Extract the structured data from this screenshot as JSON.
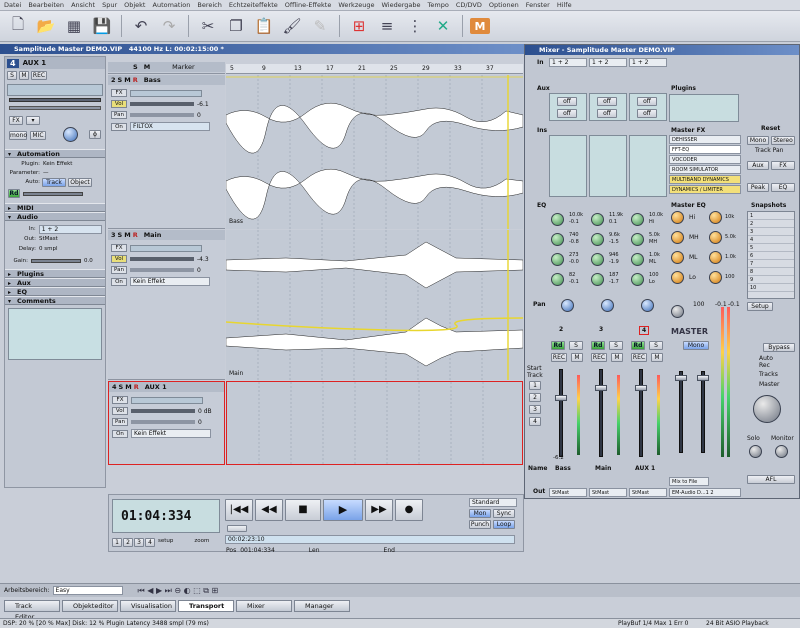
{
  "menu": [
    "Datei",
    "Bearbeiten",
    "Ansicht",
    "Spur",
    "Objekt",
    "Automation",
    "Bereich",
    "Echtzeiteffekte",
    "Offline-Effekte",
    "Werkzeuge",
    "Wiedergabe",
    "Tempo",
    "CD/DVD",
    "Optionen",
    "Fenster",
    "Hilfe"
  ],
  "arrange": {
    "title": "Samplitude Master DEMO.VIP",
    "info": "44100 Hz L: 00:02:15:00 *",
    "ruler": [
      "5",
      "9",
      "13",
      "17",
      "21",
      "25",
      "29",
      "33",
      "37"
    ],
    "marker_label": "Marker"
  },
  "inspector": {
    "track_number": "4",
    "track_name": "AUX 1",
    "mono": "mono",
    "mic": "MIC",
    "automation_header": "Automation",
    "plugin_label": "Plugin:",
    "plugin_value": "Kein Effekt",
    "parameter_label": "Parameter:",
    "auto_label": "Auto:",
    "track_btn": "Track",
    "object_btn": "Object",
    "rd": "Rd",
    "midi_header": "MIDI",
    "audio_header": "Audio",
    "in_label": "In:",
    "in_value": "1 + 2",
    "out_label": "Out:",
    "out_value": "StMast",
    "delay_label": "Delay:",
    "delay_value": "0 smpl",
    "gain_label": "Gain:",
    "gain_value": "0.0",
    "plugins_header": "Plugins",
    "aux_header": "Aux",
    "eq_header": "EQ",
    "comments_header": "Comments"
  },
  "tracks": [
    {
      "num": "2",
      "name": "Bass",
      "fx": "FX",
      "vol": "Vol",
      "vol_val": "-6.1",
      "pan": "Pan",
      "pan_val": "0",
      "on": "On",
      "plugin": "FILTOX",
      "lane_label": "Bass"
    },
    {
      "num": "3",
      "name": "Main",
      "fx": "FX",
      "vol": "Vol",
      "vol_val": "-4.3",
      "pan": "Pan",
      "pan_val": "0",
      "on": "On",
      "plugin": "Kein Effekt",
      "lane_label": "Main"
    },
    {
      "num": "4",
      "name": "AUX 1",
      "fx": "FX",
      "vol": "Vol",
      "vol_val": "0 dB",
      "pan": "Pan",
      "pan_val": "0",
      "on": "On",
      "plugin": "Kein Effekt",
      "lane_label": ""
    }
  ],
  "smr": [
    "S",
    "M",
    "R"
  ],
  "transport": {
    "time": "01:04:334",
    "position_time": "00:02:23:10",
    "pos_label": "Pos",
    "pos_value": "001:04:334",
    "len_label": "Len",
    "end_label": "End",
    "setup": "setup",
    "zoom": "zoom",
    "standard": "Standard",
    "punch": "Punch",
    "loop": "Loop",
    "mon": "Mon",
    "sync": "Sync",
    "edit": "edit",
    "pages": [
      "1",
      "2",
      "3",
      "4"
    ]
  },
  "mixer": {
    "title": "Mixer - Samplitude Master DEMO.VIP",
    "in_label": "In",
    "in_values": [
      "1 + 2",
      "1 + 2",
      "1 + 2"
    ],
    "aux_label": "Aux",
    "ins_label": "Ins",
    "eq_label": "EQ",
    "pan_label": "Pan",
    "out_label": "Out",
    "name_label": "Name",
    "off": "off",
    "plugins_label": "Plugins",
    "master_fx_label": "Master FX",
    "master_fx": [
      "DEHISSER",
      "FFT-EQ",
      "VOCODER",
      "ROOM SIMULATOR",
      "MULTIBAND DYNAMICS",
      "DYNAMICS / LIMITER"
    ],
    "master_eq_label": "Master EQ",
    "eq_bands": [
      "Hi",
      "MH",
      "ML",
      "Lo"
    ],
    "eq_freqs": [
      "10k",
      "5.0k",
      "1.0k",
      "100"
    ],
    "insert": "FILTOX",
    "channel_names": [
      "Bass",
      "Main",
      "AUX 1"
    ],
    "channel_nums": [
      "2",
      "3",
      "4"
    ],
    "channel_eq_values": [
      [
        "10.0k",
        "-0.1",
        "740",
        "-0.8",
        "273",
        "-0.0",
        "82",
        "-0.1"
      ],
      [
        "11.9k",
        "0.1",
        "9.6k",
        "-1.5",
        "946",
        "-1.9",
        "187",
        "-1.7"
      ],
      [
        "10.0k",
        "Hi",
        "5.0k",
        "MH",
        "1.0k",
        "ML",
        "100",
        "Lo"
      ]
    ],
    "master": "MASTER",
    "mono": "Mono",
    "bypass": "Bypass",
    "auto_rec": "Auto Rec",
    "tracks": "Tracks",
    "master_label": "Master",
    "solo": "Solo",
    "monitor": "Monitor",
    "reset": "Reset",
    "mono_btn": "Mono",
    "stereo_btn": "Stereo",
    "track_pan": "Track Pan",
    "aux_btn": "Aux",
    "fx_btn": "FX",
    "peak": "Peak",
    "eq_btn": "EQ",
    "snapshots": "Snapshots",
    "snapshot_nums": [
      "1",
      "2",
      "3",
      "4",
      "5",
      "6",
      "7",
      "8",
      "9",
      "10"
    ],
    "setup": "Setup",
    "start_track": "Start Track",
    "start_nums": [
      "1",
      "2",
      "3",
      "4"
    ],
    "rd": "Rd",
    "s": "S",
    "m": "M",
    "rec": "REC",
    "out_values": [
      "StMast",
      "StMast",
      "StMast"
    ],
    "master_out": "Mix to File",
    "audio_out": "EM-Audio D...1 2",
    "afl": "AFL",
    "master_db": "100",
    "master_l": "-0.1",
    "master_r": "-0.1",
    "fader_db": [
      "-6.2",
      "",
      ""
    ]
  },
  "bottom": {
    "workspace_label": "Arbeitsbereich:",
    "workspace_value": "Easy",
    "tabs": [
      "Track Editor",
      "Objekteditor",
      "Visualisation",
      "Transport",
      "Mixer",
      "Manager"
    ],
    "active_tab": "Transport"
  },
  "status": {
    "left": "DSP: 20 %  [20 % Max]   Disk: 12 %  Plugin Latency 3488 smpl (79 ms)",
    "playbuf": "PlayBuf 1/4  Max 1  Err 0",
    "right": "24 Bit ASIO Playback"
  }
}
